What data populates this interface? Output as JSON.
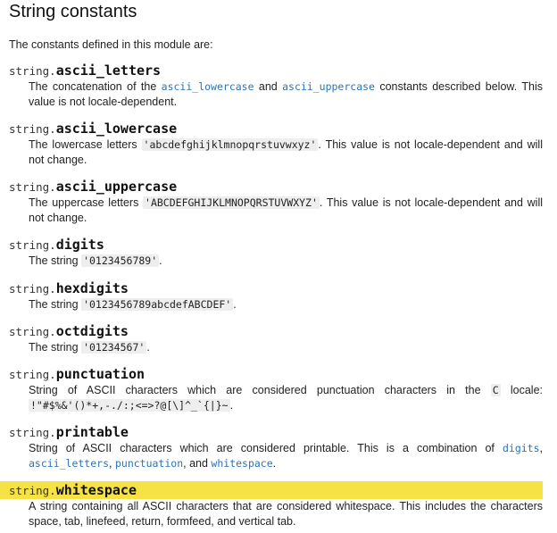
{
  "section": {
    "title": "String constants",
    "intro": "The constants defined in this module are:"
  },
  "entries": [
    {
      "module": "string.",
      "name": "ascii_letters",
      "desc": {
        "t0": "The concatenation of the ",
        "link0": "ascii_lowercase",
        "t1": " and ",
        "link1": "ascii_uppercase",
        "t2": " constants described below. This value is not locale-dependent."
      }
    },
    {
      "module": "string.",
      "name": "ascii_lowercase",
      "desc": {
        "t0": "The lowercase letters ",
        "lit": "'abcdefghijklmnopqrstuvwxyz'",
        "t1": ". This value is not locale-dependent and will not change."
      }
    },
    {
      "module": "string.",
      "name": "ascii_uppercase",
      "desc": {
        "t0": "The uppercase letters ",
        "lit": "'ABCDEFGHIJKLMNOPQRSTUVWXYZ'",
        "t1": ". This value is not locale-dependent and will not change."
      }
    },
    {
      "module": "string.",
      "name": "digits",
      "desc": {
        "t0": "The string ",
        "lit": "'0123456789'",
        "t1": "."
      }
    },
    {
      "module": "string.",
      "name": "hexdigits",
      "desc": {
        "t0": "The string ",
        "lit": "'0123456789abcdefABCDEF'",
        "t1": "."
      }
    },
    {
      "module": "string.",
      "name": "octdigits",
      "desc": {
        "t0": "The string ",
        "lit": "'01234567'",
        "t1": "."
      }
    },
    {
      "module": "string.",
      "name": "punctuation",
      "desc": {
        "t0": "String of ASCII characters which are considered punctuation characters in the ",
        "lit": "C",
        "t1": " locale: ",
        "lit2": "!\"#$%&'()*+,-./:;<=>?@[\\]^_`{|}~",
        "t2": "."
      }
    },
    {
      "module": "string.",
      "name": "printable",
      "desc": {
        "t0": "String of ASCII characters which are considered printable. This is a combination of ",
        "link0": "digits",
        "t1": ", ",
        "link1": "ascii_letters",
        "t2": ", ",
        "link2": "punctuation",
        "t3": ", and ",
        "link3": "whitespace",
        "t4": "."
      }
    },
    {
      "module": "string.",
      "name": "whitespace",
      "highlighted": true,
      "desc": {
        "t0": "A string containing all ASCII characters that are considered whitespace. This includes the characters space, tab, linefeed, return, formfeed, and vertical tab."
      }
    }
  ],
  "colors": {
    "link": "#2a73b8",
    "highlight": "#f6e244",
    "literal_bg": "#eeeeee"
  }
}
